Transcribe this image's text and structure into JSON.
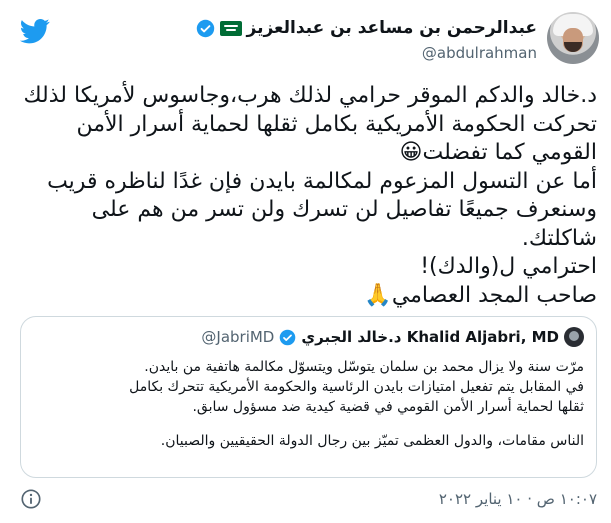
{
  "user": {
    "display_name": "عبدالرحمن بن مساعد بن عبدالعزيز",
    "handle": "@abdulrahman",
    "flag_icon": "saudi-flag-icon",
    "verified_icon": "verified-badge-icon"
  },
  "tweet": {
    "lines": [
      "د.خالد والدكم الموقر حرامي لذلك هرب،وجاسوس لأمريكا لذلك",
      "تحركت الحكومة الأمريكية بكامل ثقلها لحماية أسرار الأمن",
      "القومي كما تفضلت",
      "أما عن التسول المزعوم لمكالمة بايدن فإن غدًا لناظره قريب",
      "وسنعرف جميعًا تفاصيل لن تسرك ولن تسر من هم على",
      "شاكلتك.",
      "احترامي ل(والدك)!",
      "صاحب المجد العصامي"
    ],
    "emoji_line3": "😀",
    "emoji_line8": "🙏"
  },
  "quoted": {
    "name": "د.خالد الجبري Khalid Aljabri, MD",
    "handle": "@JabriMD",
    "lines": [
      "مرّت سنة ولا يزال محمد بن سلمان يتوسّل ويتسوّل مكالمة هاتفية من بايدن.",
      "في المقابل يتم تفعيل امتيازات بايدن الرئاسية والحكومة الأمريكية تتحرك بكامل",
      "ثقلها لحماية أسرار الأمن القومي في قضية كيدية ضد مسؤول سابق.",
      "الناس مقامات، والدول العظمى تميّز بين رجال الدولة الحقيقيين والصبيان."
    ]
  },
  "footer": {
    "timestamp": "١٠:٠٧ ص · ١٠ يناير ٢٠٢٢"
  },
  "colors": {
    "twitter_blue": "#1d9bf0",
    "text": "#0f1419",
    "secondary": "#536471",
    "border": "#cfd9de",
    "flag_green": "#006c35"
  }
}
